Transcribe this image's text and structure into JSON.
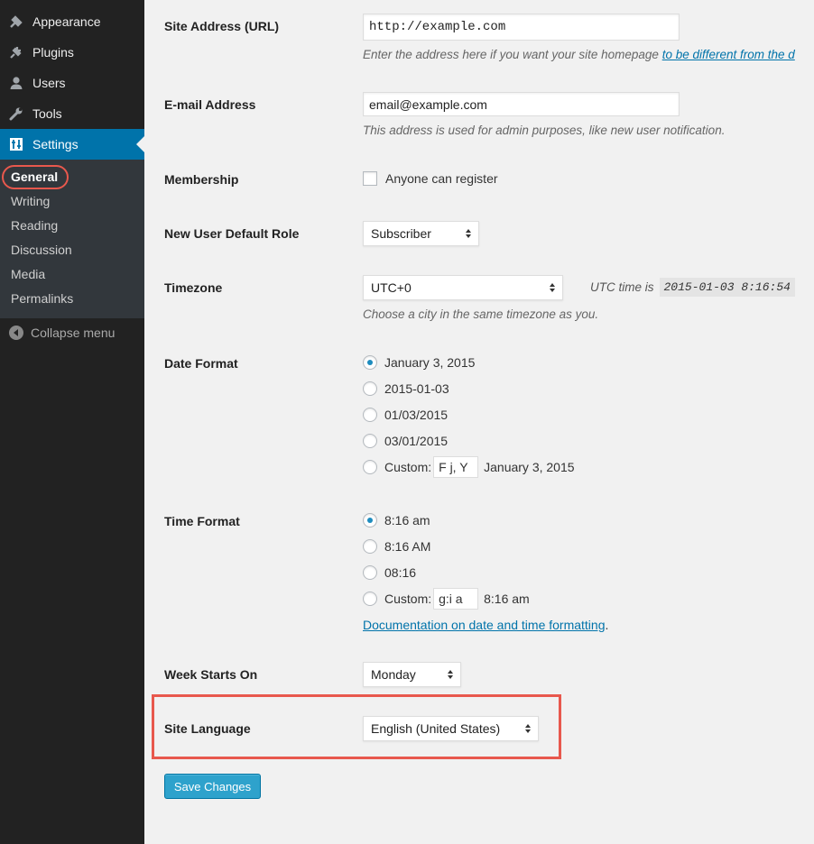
{
  "sidebar": {
    "menu": [
      {
        "label": "Appearance",
        "icon": "appearance-icon"
      },
      {
        "label": "Plugins",
        "icon": "plugins-icon"
      },
      {
        "label": "Users",
        "icon": "users-icon"
      },
      {
        "label": "Tools",
        "icon": "tools-icon"
      },
      {
        "label": "Settings",
        "icon": "settings-icon"
      }
    ],
    "submenu": [
      "General",
      "Writing",
      "Reading",
      "Discussion",
      "Media",
      "Permalinks"
    ],
    "collapse_label": "Collapse menu"
  },
  "form": {
    "site_address": {
      "label": "Site Address (URL)",
      "value": "http://example.com",
      "desc_prefix": "Enter the address here if you want your site homepage ",
      "desc_link": "to be different from the d"
    },
    "email": {
      "label": "E-mail Address",
      "value": "email@example.com",
      "desc": "This address is used for admin purposes, like new user notification."
    },
    "membership": {
      "label": "Membership",
      "checkbox_label": "Anyone can register",
      "checked": false
    },
    "default_role": {
      "label": "New User Default Role",
      "value": "Subscriber"
    },
    "timezone": {
      "label": "Timezone",
      "value": "UTC+0",
      "utc_label": "UTC time is",
      "utc_time": "2015-01-03 8:16:54",
      "desc": "Choose a city in the same timezone as you."
    },
    "date_format": {
      "label": "Date Format",
      "options": [
        "January 3, 2015",
        "2015-01-03",
        "01/03/2015",
        "03/01/2015"
      ],
      "selected": 0,
      "custom_label": "Custom:",
      "custom_value": "F j, Y",
      "custom_preview": "January 3, 2015"
    },
    "time_format": {
      "label": "Time Format",
      "options": [
        "8:16 am",
        "8:16 AM",
        "08:16"
      ],
      "selected": 0,
      "custom_label": "Custom:",
      "custom_value": "g:i a",
      "custom_preview": "8:16 am",
      "doc_link": "Documentation on date and time formatting",
      "doc_suffix": "."
    },
    "week_starts": {
      "label": "Week Starts On",
      "value": "Monday"
    },
    "site_language": {
      "label": "Site Language",
      "value": "English (United States)"
    },
    "save_label": "Save Changes"
  },
  "colors": {
    "accent": "#0073aa",
    "highlight": "#e8584d",
    "button": "#2ea2cc"
  }
}
